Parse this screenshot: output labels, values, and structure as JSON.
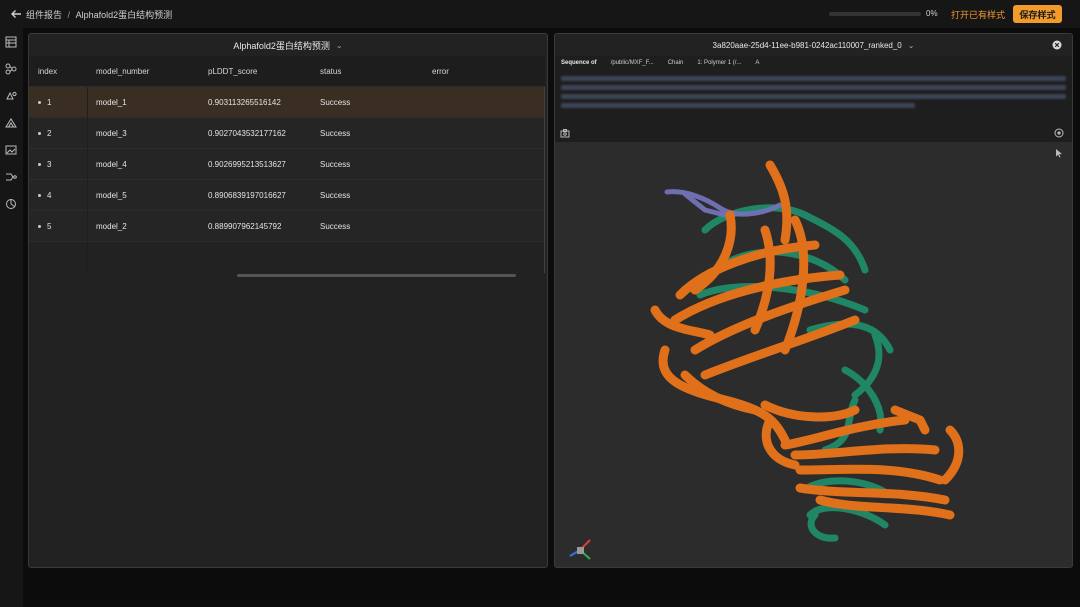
{
  "header": {
    "breadcrumb_parent": "组件报告",
    "breadcrumb_sep": "/",
    "breadcrumb_current": "Alphafold2蛋白结构预测",
    "progress_text": "0%",
    "progress_value": 0,
    "open_styles_label": "打开已有样式",
    "save_styles_label": "保存样式"
  },
  "sidebar": {
    "icons": [
      "table-icon",
      "nodes-icon",
      "molecule-icon",
      "structure-icon",
      "image-icon",
      "workflow-icon",
      "chart-pie-icon"
    ]
  },
  "left_panel": {
    "title": "Alphafold2蛋白结构预测",
    "columns": [
      "index",
      "model_number",
      "pLDDT_score",
      "status",
      "error"
    ],
    "rows": [
      {
        "index": "1",
        "model_number": "model_1",
        "plddt": "0.903113265516142",
        "status": "Success",
        "error": ""
      },
      {
        "index": "2",
        "model_number": "model_3",
        "plddt": "0.9027043532177162",
        "status": "Success",
        "error": ""
      },
      {
        "index": "3",
        "model_number": "model_4",
        "plddt": "0.9026995213513627",
        "status": "Success",
        "error": ""
      },
      {
        "index": "4",
        "model_number": "model_5",
        "plddt": "0.8906839197016627",
        "status": "Success",
        "error": ""
      },
      {
        "index": "5",
        "model_number": "model_2",
        "plddt": "0.889907962145792",
        "status": "Success",
        "error": ""
      }
    ]
  },
  "right_panel": {
    "title": "3a820aae-25d4-11ee-b981-0242ac110007_ranked_0",
    "sequence_label": "Sequence of",
    "sequence_path": "/public/MXF_F...",
    "chain_label": "Chain",
    "polymer_label": "1: Polymer 1 (/...",
    "chain_value": "A"
  },
  "colors": {
    "accent": "#f29b2a",
    "chain_a": "#e0701a",
    "chain_b": "#1f8c6a",
    "tail": "#7372b8"
  }
}
